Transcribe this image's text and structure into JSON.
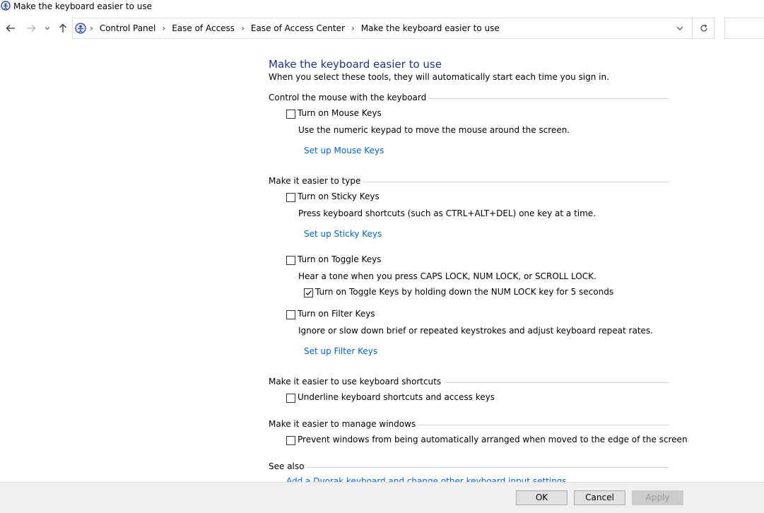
{
  "window": {
    "title": "Make the keyboard easier to use",
    "icon": "control-panel-icon"
  },
  "nav": {
    "back_icon": "back-arrow-icon",
    "forward_icon": "forward-arrow-icon",
    "recent_icon": "chevron-down-icon",
    "up_icon": "up-arrow-icon",
    "breadcrumb": [
      "Control Panel",
      "Ease of Access",
      "Ease of Access Center",
      "Make the keyboard easier to use"
    ],
    "separator": "›",
    "dropdown_icon": "chevron-down-icon",
    "refresh_icon": "refresh-icon"
  },
  "page": {
    "heading": "Make the keyboard easier to use",
    "intro": "When you select these tools, they will automatically start each time you sign in.",
    "heading_color": "#1e3287",
    "link_color": "#0066cc"
  },
  "sections": {
    "mouse": {
      "title": "Control the mouse with the keyboard",
      "mouse_keys": {
        "label": "Turn on Mouse Keys",
        "checked": false
      },
      "mouse_keys_desc": "Use the numeric keypad to move the mouse around the screen.",
      "mouse_keys_link": "Set up Mouse Keys"
    },
    "type": {
      "title": "Make it easier to type",
      "sticky_keys": {
        "label": "Turn on Sticky Keys",
        "checked": false
      },
      "sticky_keys_desc": "Press keyboard shortcuts (such as CTRL+ALT+DEL) one key at a time.",
      "sticky_keys_link": "Set up Sticky Keys",
      "toggle_keys": {
        "label": "Turn on Toggle Keys",
        "checked": false
      },
      "toggle_keys_desc": "Hear a tone when you press CAPS LOCK, NUM LOCK, or SCROLL LOCK.",
      "toggle_keys_hold": {
        "label": "Turn on Toggle Keys by holding down the NUM LOCK key for 5 seconds",
        "checked": true
      },
      "filter_keys": {
        "label": "Turn on Filter Keys",
        "checked": false
      },
      "filter_keys_desc": "Ignore or slow down brief or repeated keystrokes and adjust keyboard repeat rates.",
      "filter_keys_link": "Set up Filter Keys"
    },
    "shortcuts": {
      "title": "Make it easier to use keyboard shortcuts",
      "underline": {
        "label": "Underline keyboard shortcuts and access keys",
        "checked": false
      }
    },
    "windows": {
      "title": "Make it easier to manage windows",
      "prevent_arrange": {
        "label": "Prevent windows from being automatically arranged when moved to the edge of the screen",
        "checked": false
      }
    },
    "see_also": {
      "title": "See also",
      "dvorak_link": "Add a Dvorak keyboard and change other keyboard input settings"
    }
  },
  "buttons": {
    "ok": "OK",
    "cancel": "Cancel",
    "apply": "Apply"
  }
}
